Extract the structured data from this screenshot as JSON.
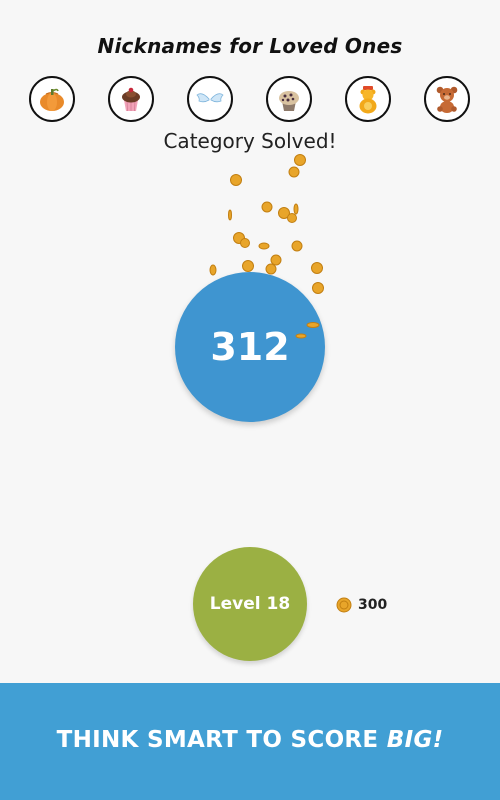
{
  "header": {
    "title": "Nicknames for Loved Ones"
  },
  "solved_icons": [
    {
      "name": "pumpkin-icon"
    },
    {
      "name": "cupcake-icon"
    },
    {
      "name": "angel-wings-icon"
    },
    {
      "name": "muffin-icon"
    },
    {
      "name": "honey-bear-icon"
    },
    {
      "name": "teddy-bear-icon"
    }
  ],
  "status": {
    "message": "Category Solved!"
  },
  "score": {
    "value": "312"
  },
  "level": {
    "label": "Level 18"
  },
  "coins": {
    "amount": "300"
  },
  "banner": {
    "text_main": "THINK SMART TO SCORE ",
    "text_emphasis": "BIG!"
  },
  "colors": {
    "score_circle": "#3f95d0",
    "level_button": "#9bb043",
    "banner": "#419fd4",
    "coin": "#e8a52a",
    "background": "#f7f7f7"
  }
}
